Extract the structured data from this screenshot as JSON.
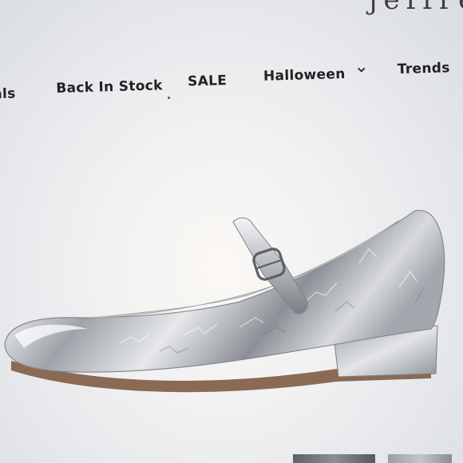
{
  "brand": {
    "logo_text": "jeffrey"
  },
  "nav": {
    "items": [
      {
        "label": "rals"
      },
      {
        "label": "Back In Stock"
      },
      {
        "label": "SALE"
      },
      {
        "label": "Halloween",
        "has_dropdown": true
      },
      {
        "label": "Trends"
      }
    ]
  },
  "product": {
    "image_icon": "silver-metallic-mary-jane-shoe",
    "colors": {
      "metal_light": "#f2f3f5",
      "metal_mid": "#b9bcc1",
      "metal_dark": "#6e7278",
      "sole": "#8a6a55"
    }
  },
  "thumbnails": {
    "count": 2
  }
}
